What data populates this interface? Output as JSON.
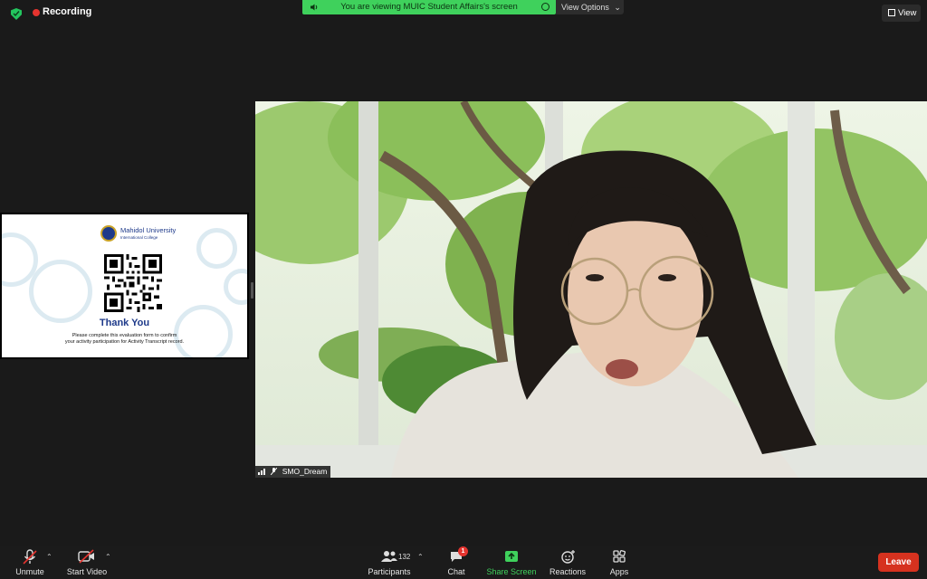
{
  "topbar": {
    "recording_label": "Recording",
    "viewing_text": "You are viewing MUIC Student Affairs's screen",
    "view_options_label": "View Options",
    "view_button_label": "View"
  },
  "slide": {
    "university": "Mahidol University",
    "college": "International College",
    "thank_you": "Thank You",
    "instruction_line1": "Please complete this evaluation form to confirm",
    "instruction_line2": "your activity participation for Activity Transcript record."
  },
  "participant": {
    "name": "SMO_Dream"
  },
  "toolbar": {
    "unmute": "Unmute",
    "start_video": "Start Video",
    "participants": "Participants",
    "participants_count": "132",
    "chat": "Chat",
    "chat_badge": "1",
    "share_screen": "Share Screen",
    "reactions": "Reactions",
    "apps": "Apps",
    "leave": "Leave"
  },
  "colors": {
    "share_green": "#3fd15c",
    "leave_red": "#d6321f",
    "recording_red": "#e5342f",
    "muic_blue": "#1e3a8a"
  }
}
